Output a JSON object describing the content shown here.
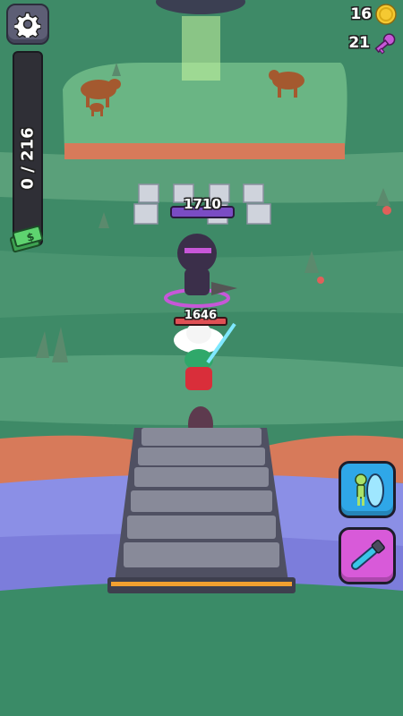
{
  "hud": {
    "progress": {
      "label": "0 / 216",
      "fraction": 0
    },
    "coins": {
      "value": "16"
    },
    "keys": {
      "value": "21"
    }
  },
  "enemy": {
    "hp_label": "1710"
  },
  "player": {
    "hp_label": "1646"
  },
  "abilities": [
    {
      "icon": "alien-portal-icon"
    },
    {
      "icon": "laser-sword-icon"
    }
  ],
  "colors": {
    "coin": "#f5c932",
    "key": "#c757d8",
    "cash": "#4cc262",
    "enemy_hp": "#7a4cc4",
    "player_hp": "#e05055"
  }
}
